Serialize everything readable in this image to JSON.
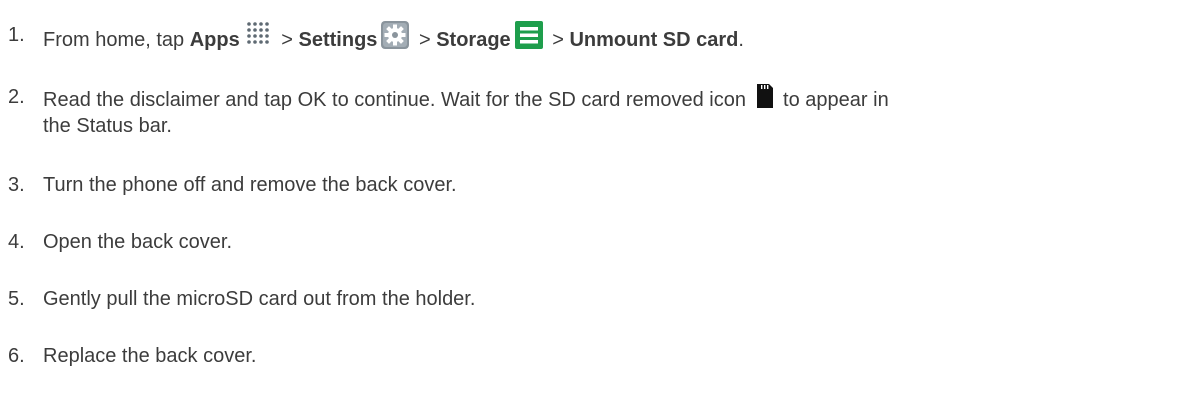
{
  "steps": [
    {
      "number": "1.",
      "from_home": "From home, tap ",
      "apps_label": "Apps",
      "sep1": " > ",
      "settings_label": "Settings",
      "sep2": " > ",
      "storage_label": "Storage",
      "sep3": " > ",
      "unmount_label": "Unmount SD card",
      "end": "."
    },
    {
      "number": "2.",
      "text_a": "Read the disclaimer and tap OK to continue. Wait for the SD card removed icon ",
      "text_b": " to appear in",
      "text_c": "the Status bar."
    },
    {
      "number": "3.",
      "text": "Turn the phone off and remove the back cover."
    },
    {
      "number": "4.",
      "text": "Open the back cover."
    },
    {
      "number": "5.",
      "text": "Gently pull the microSD card out from the holder."
    },
    {
      "number": "6.",
      "text": "Replace the back cover."
    }
  ],
  "icons": {
    "apps": "apps-grid-icon",
    "settings": "settings-gear-icon",
    "storage": "storage-icon",
    "sd_removed": "sd-card-removed-icon"
  },
  "colors": {
    "text": "#3c3c3c",
    "storage_green": "#1e9e4c",
    "settings_gray": "#7d8790"
  }
}
